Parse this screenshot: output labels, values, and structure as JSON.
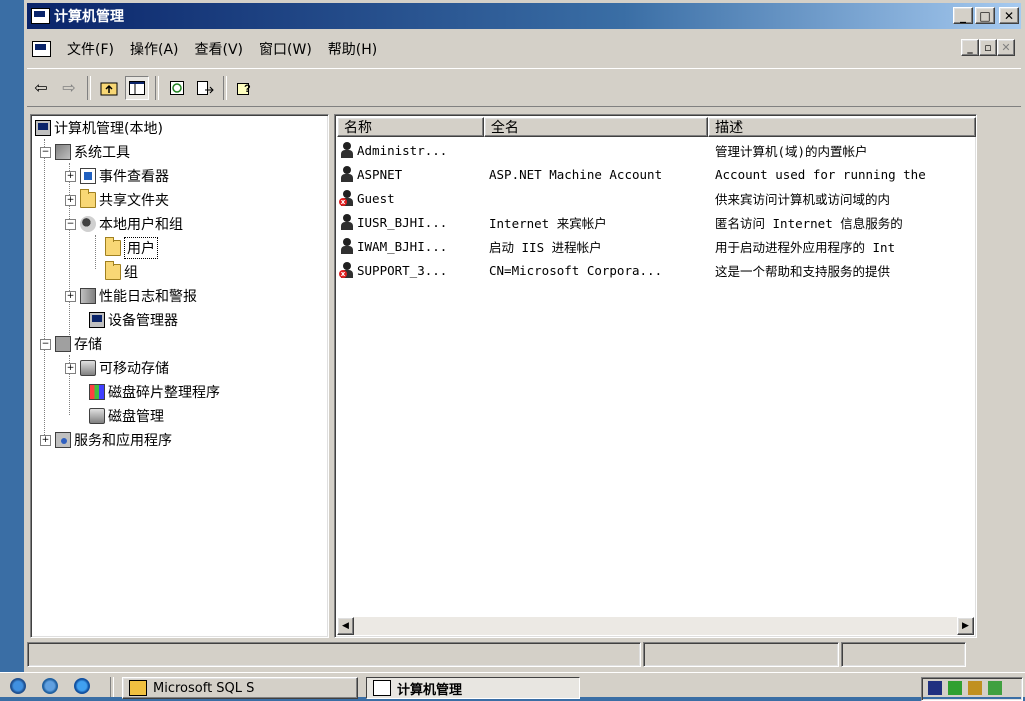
{
  "window": {
    "title": "计算机管理"
  },
  "menubar": {
    "items": [
      "文件(F)",
      "操作(A)",
      "查看(V)",
      "窗口(W)",
      "帮助(H)"
    ],
    "mdi_buttons": [
      "_",
      "▫",
      "✕"
    ]
  },
  "caption_buttons": [
    "_",
    "□",
    "✕"
  ],
  "toolbar": {
    "buttons": [
      "back-arrow-icon",
      "forward-arrow-icon",
      "up-folder-icon",
      "show-hide-tree-icon",
      "refresh-icon",
      "export-list-icon",
      "help-icon"
    ]
  },
  "tree": {
    "root": "计算机管理(本地)",
    "system_tools": "系统工具",
    "event_viewer": "事件查看器",
    "shared_folders": "共享文件夹",
    "local_users_groups": "本地用户和组",
    "users": "用户",
    "groups": "组",
    "perf_logs": "性能日志和警报",
    "device_manager": "设备管理器",
    "storage": "存储",
    "removable_storage": "可移动存储",
    "disk_defrag": "磁盘碎片整理程序",
    "disk_management": "磁盘管理",
    "services_apps": "服务和应用程序"
  },
  "list": {
    "columns": [
      "名称",
      "全名",
      "描述"
    ],
    "rows": [
      {
        "name": "Administr...",
        "full_name": "",
        "description": "管理计算机(域)的内置帐户",
        "disabled": false
      },
      {
        "name": "ASPNET",
        "full_name": "ASP.NET Machine Account",
        "description": "Account used for running the",
        "disabled": false
      },
      {
        "name": "Guest",
        "full_name": "",
        "description": "供来宾访问计算机或访问域的内",
        "disabled": true
      },
      {
        "name": "IUSR_BJHI...",
        "full_name": "Internet 来宾帐户",
        "description": "匿名访问 Internet 信息服务的",
        "disabled": false
      },
      {
        "name": "IWAM_BJHI...",
        "full_name": "启动 IIS 进程帐户",
        "description": "用于启动进程外应用程序的 Int",
        "disabled": false
      },
      {
        "name": "SUPPORT_3...",
        "full_name": "CN=Microsoft Corpora...",
        "description": "这是一个帮助和支持服务的提供",
        "disabled": true
      }
    ]
  },
  "taskbar": {
    "tasks": [
      {
        "label": "Microsoft SQL S",
        "active": false
      },
      {
        "label": "计算机管理",
        "active": true
      }
    ]
  },
  "colors": {
    "title_start": "#0a246a",
    "title_end": "#a6caf0",
    "face": "#d4d0c8",
    "desktop": "#3a6ea5"
  }
}
